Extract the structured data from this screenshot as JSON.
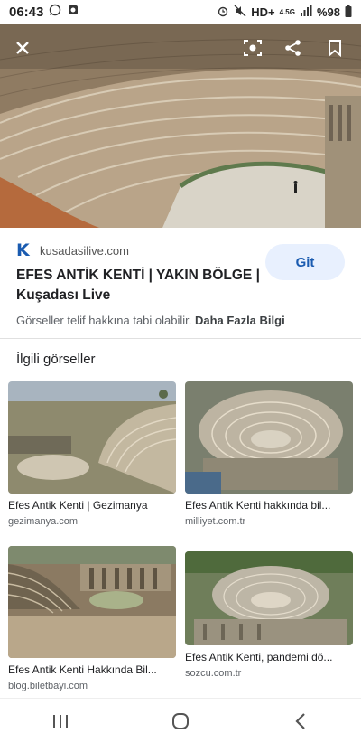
{
  "status_bar": {
    "time": "06:43",
    "network": "HD+",
    "signal_type": "4.5G",
    "battery": "%98"
  },
  "hero": {
    "alt": "Efes Antik Tiyatrosu"
  },
  "result": {
    "source_domain": "kusadasilive.com",
    "title": "EFES ANTİK KENTİ | YAKIN BÖLGE | Kuşadası Live",
    "visit_label": "Git",
    "copyright_text": "Görseller telif hakkına tabi olabilir.",
    "more_info": "Daha Fazla Bilgi"
  },
  "related": {
    "heading": "İlgili görseller",
    "items": [
      {
        "caption": "Efes Antik Kenti | Gezimanya",
        "domain": "gezimanya.com"
      },
      {
        "caption": "Efes Antik Kenti hakkında bil...",
        "domain": "milliyet.com.tr"
      },
      {
        "caption": "Efes Antik Kenti Hakkında Bil...",
        "domain": "blog.biletbayi.com"
      },
      {
        "caption": "Efes Antik Kenti, pandemi dö...",
        "domain": "sozcu.com.tr"
      }
    ]
  },
  "icons": {
    "close": "close-icon",
    "lens": "lens-icon",
    "share": "share-icon",
    "bookmark": "bookmark-icon"
  }
}
